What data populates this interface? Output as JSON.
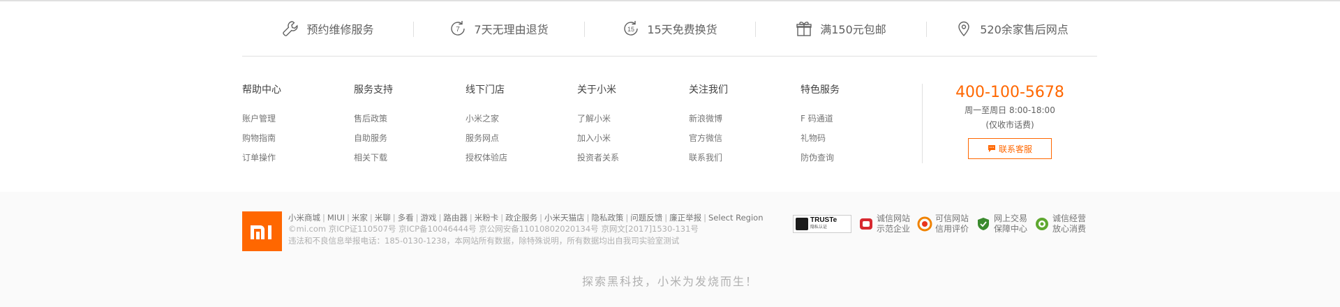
{
  "services": [
    {
      "icon": "wrench-icon",
      "label": "预约维修服务"
    },
    {
      "icon": "seven-day-return-icon",
      "label": "7天无理由退货",
      "num": "7"
    },
    {
      "icon": "fifteen-day-exchange-icon",
      "label": "15天免费换货",
      "num": "15"
    },
    {
      "icon": "gift-icon",
      "label": "满150元包邮"
    },
    {
      "icon": "location-pin-icon",
      "label": "520余家售后网点"
    }
  ],
  "columns": [
    {
      "title": "帮助中心",
      "links": [
        "账户管理",
        "购物指南",
        "订单操作"
      ]
    },
    {
      "title": "服务支持",
      "links": [
        "售后政策",
        "自助服务",
        "相关下载"
      ]
    },
    {
      "title": "线下门店",
      "links": [
        "小米之家",
        "服务网点",
        "授权体验店"
      ]
    },
    {
      "title": "关于小米",
      "links": [
        "了解小米",
        "加入小米",
        "投资者关系"
      ]
    },
    {
      "title": "关注我们",
      "links": [
        "新浪微博",
        "官方微信",
        "联系我们"
      ]
    },
    {
      "title": "特色服务",
      "links": [
        "F 码通道",
        "礼物码",
        "防伪查询"
      ]
    }
  ],
  "contact": {
    "phone": "400-100-5678",
    "hours": "周一至周日 8:00-18:00",
    "note": "(仅收市话费)",
    "button": "联系客服"
  },
  "site_links": [
    "小米商城",
    "MIUI",
    "米家",
    "米聊",
    "多看",
    "游戏",
    "路由器",
    "米粉卡",
    "政企服务",
    "小米天猫店",
    "隐私政策",
    "问题反馈",
    "廉正举报",
    "Select Region"
  ],
  "legal": {
    "icp": "©mi.com 京ICP证110507号 京ICP备10046444号 京公网安备11010802020134号 京网文[2017]1530-131号",
    "report": "违法和不良信息举报电话：185-0130-1238，本网站所有数据，除特殊说明，所有数据均出自我司实验室测试"
  },
  "badges": {
    "truste": "TRUSTe",
    "truste_sub": "隐私认证",
    "items": [
      {
        "line1": "诚信网站",
        "line2": "示范企业",
        "color": "#d7282f"
      },
      {
        "line1": "可信网站",
        "line2": "信用评价",
        "color": "#f08200"
      },
      {
        "line1": "网上交易",
        "line2": "保障中心",
        "color": "#3a8a2e"
      },
      {
        "line1": "诚信经营",
        "line2": "放心消费",
        "color": "#5fa830"
      }
    ]
  },
  "slogan": "探索黑科技，小米为发烧而生！",
  "colors": {
    "accent": "#ff6700",
    "text": "#424242",
    "muted": "#757575",
    "light": "#b0b0b0"
  }
}
